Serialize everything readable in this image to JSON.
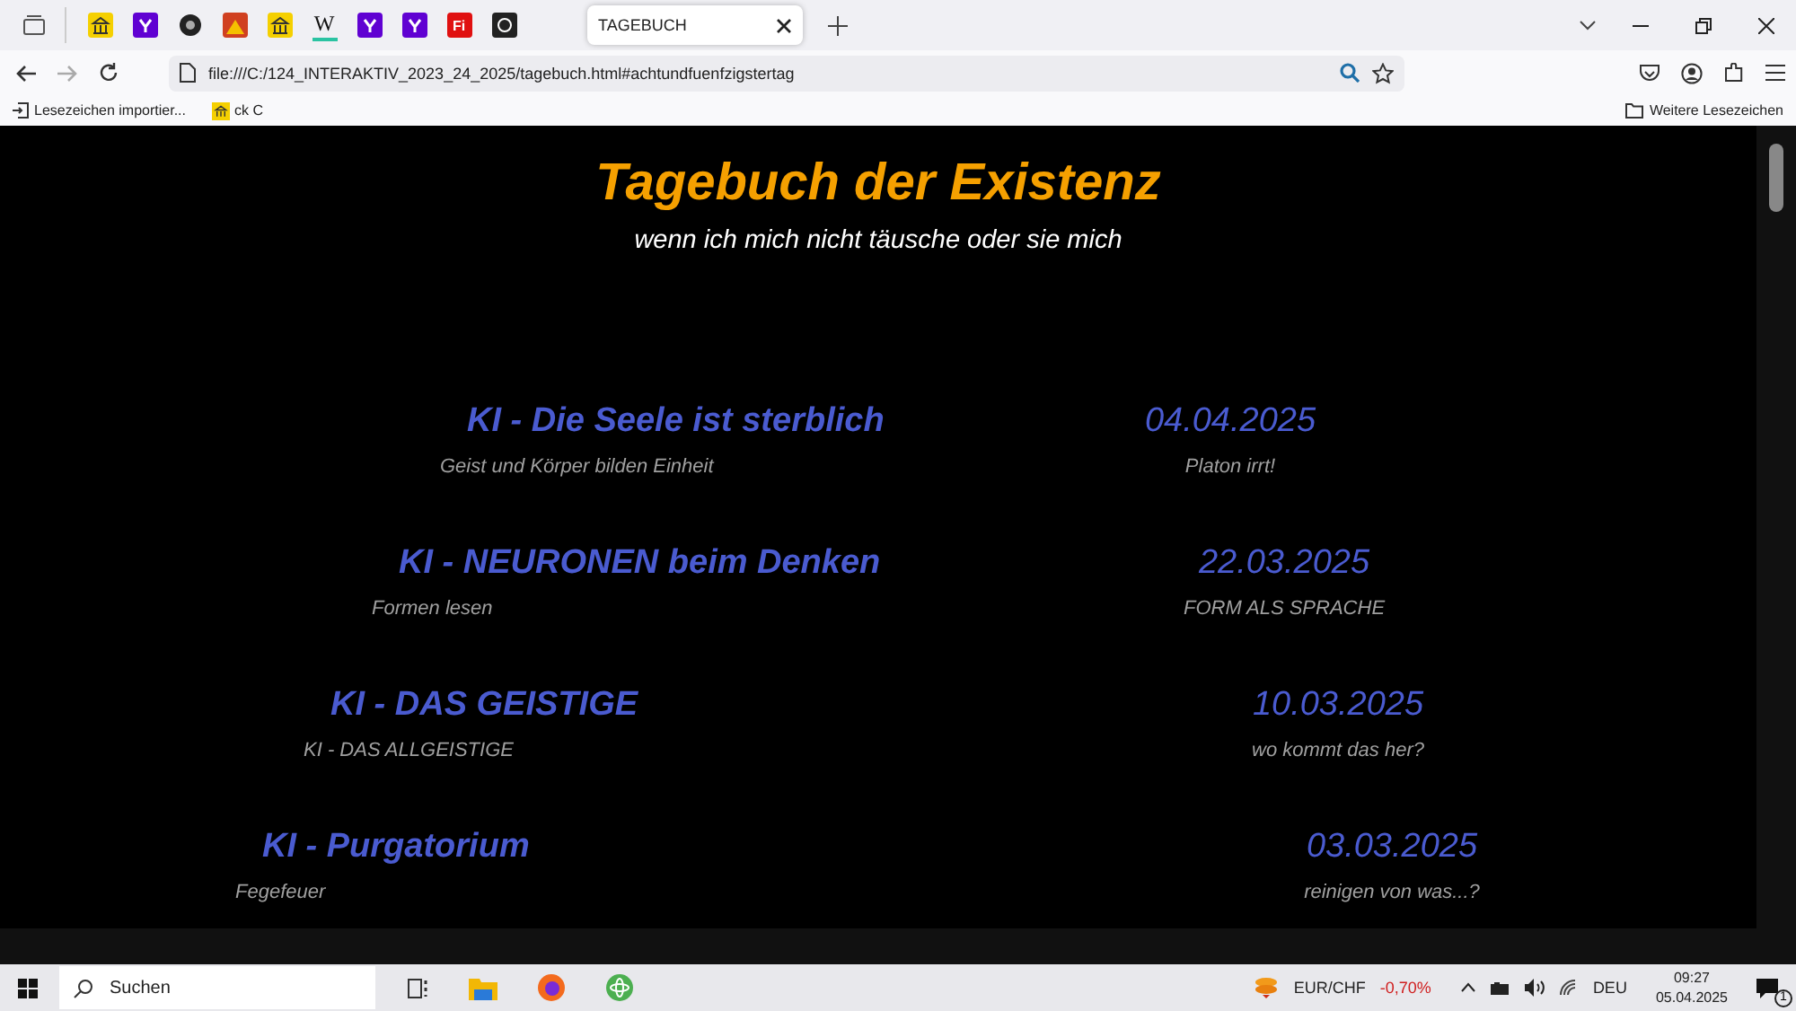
{
  "browser": {
    "pinned_tabs": [
      {
        "kind": "bank"
      },
      {
        "kind": "y"
      },
      {
        "kind": "disc"
      },
      {
        "kind": "img"
      },
      {
        "kind": "bank"
      },
      {
        "kind": "w"
      },
      {
        "kind": "y"
      },
      {
        "kind": "y"
      },
      {
        "kind": "fi"
      },
      {
        "kind": "dark"
      }
    ],
    "pinned_labels": [
      "W",
      "Fi"
    ],
    "tab": {
      "title": "TAGEBUCH",
      "selected": true
    },
    "url": "file:///C:/124_INTERAKTIV_2023_24_2025/tagebuch.html#achtundfuenfzigstertag",
    "bookmarks": [
      "Lesezeichen importier...",
      "ck C"
    ],
    "other_bookmarks": "Weitere Lesezeichen"
  },
  "page": {
    "title": "Tagebuch der Existenz",
    "subtitle": "wenn ich mich nicht täusche oder sie mich",
    "entries": [
      {
        "title": "KI - Die Seele ist sterblich",
        "subtitle": "Geist und Körper bilden Einheit",
        "date": "04.04.2025",
        "note": "Platon irrt!"
      },
      {
        "title": "KI - NEURONEN beim Denken",
        "subtitle": "Formen lesen",
        "date": "22.03.2025",
        "note": "FORM ALS SPRACHE"
      },
      {
        "title": "KI - DAS GEISTIGE",
        "subtitle": "KI - DAS ALLGEISTIGE",
        "date": "10.03.2025",
        "note": "wo kommt das her?"
      },
      {
        "title": "KI - Purgatorium",
        "subtitle": "Fegefeuer",
        "date": "03.03.2025",
        "note": "reinigen von was...?"
      }
    ]
  },
  "taskbar": {
    "search_placeholder": "Suchen",
    "ticker": "EUR/CHF",
    "change": "-0,70%",
    "language": "DEU",
    "time": "09:27",
    "date": "05.04.2025",
    "notifications": "1"
  }
}
